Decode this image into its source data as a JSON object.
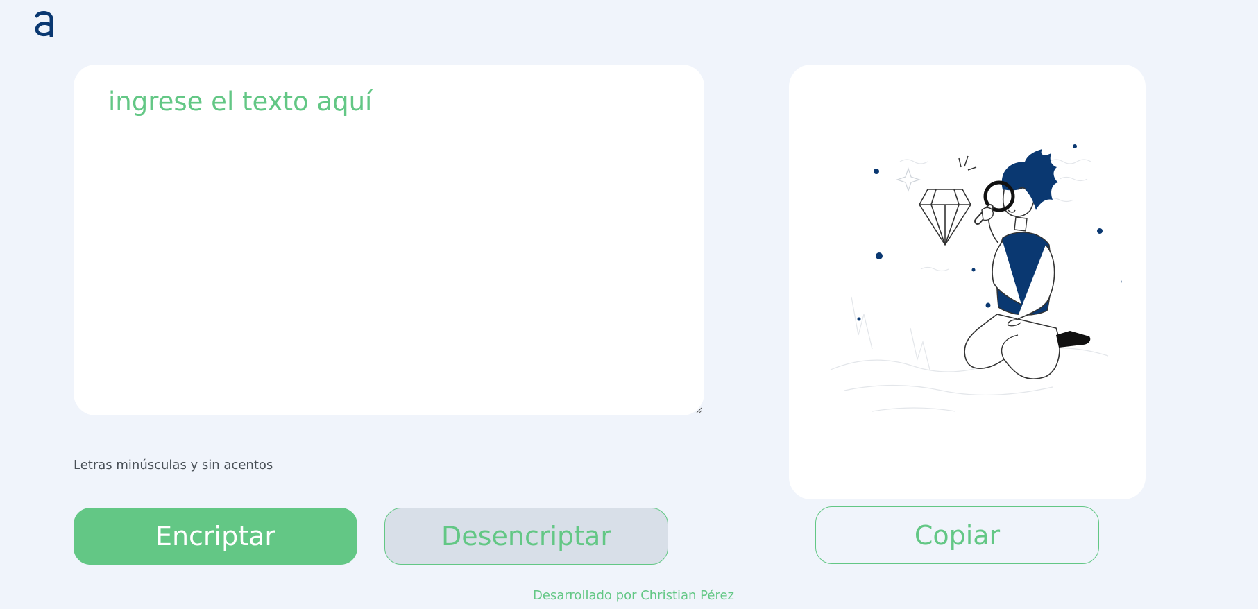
{
  "header": {
    "logo_icon": "alura-logo-icon"
  },
  "input": {
    "placeholder": "ingrese el texto aquí",
    "value": ""
  },
  "hint": {
    "icon": "info-icon",
    "text": "Letras minúsculas y sin acentos"
  },
  "buttons": {
    "encrypt_label": "Encriptar",
    "decrypt_label": "Desencriptar",
    "copy_label": "Copiar"
  },
  "output": {
    "illustration": "person-magnifying-glass-illustration"
  },
  "footer": {
    "text": "Desarrollado por Christian Pérez"
  },
  "colors": {
    "background": "#f0f4fb",
    "accent_green": "#63c785",
    "brand_blue": "#0a3871",
    "card": "#ffffff",
    "secondary_button": "#d8dfe8"
  }
}
